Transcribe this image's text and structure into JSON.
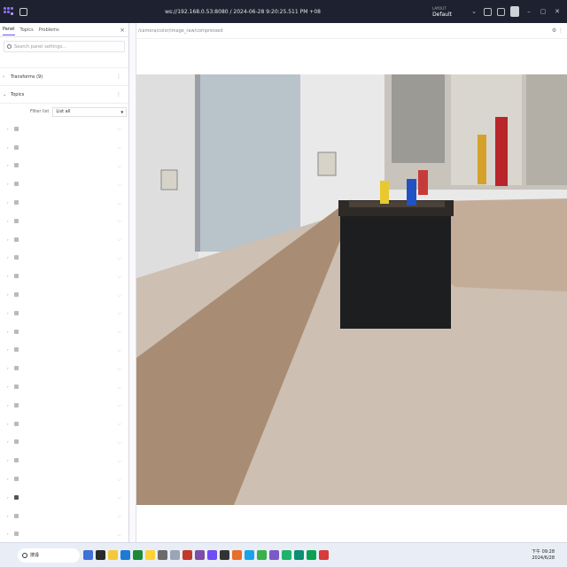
{
  "titlebar": {
    "title": "ws://192.168.0.53:8080 / 2024-06-28 9:20:25.511 PM +08",
    "layout_caption": "LAYOUT",
    "layout_value": "Default"
  },
  "panel": {
    "tabs": [
      "Panel",
      "Topics",
      "Problems"
    ],
    "search_placeholder": "Search panel settings...",
    "sections": {
      "transforms_label": "Transforms (9)",
      "topics_label": "Topics"
    },
    "filter_label": "Filter list",
    "filter_value": "List all"
  },
  "image_panel": {
    "topic_path": "/camera/color/image_raw/compressed"
  },
  "taskbar": {
    "search_placeholder": "搜尋",
    "time": "下午 09:28",
    "date": "2024/6/28"
  },
  "icons": {
    "logo": "foxglove-logo-icon",
    "search": "search-icon",
    "kebab": "kebab-menu-icon",
    "chevron": "chevron-icon",
    "close": "close-icon"
  },
  "colors": {
    "titlebar_bg": "#1e2230",
    "accent": "#6f4cf5",
    "taskbar_bg": "#e9eef6"
  }
}
